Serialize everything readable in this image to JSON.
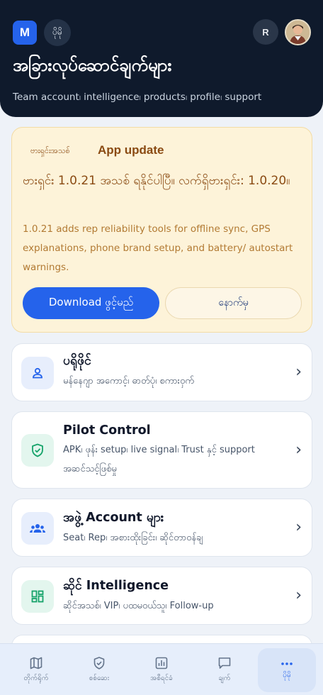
{
  "header": {
    "logo_letter": "M",
    "more_label": "ပိုမို",
    "user_initial": "R",
    "title": "အခြားလုပ်ဆောင်ချက်များ",
    "subtitle": "Team account၊ intelligence၊ products၊ profile၊ support"
  },
  "update": {
    "badge": "ဗားရှင်းအသစ်",
    "title": "App update",
    "headline": "ဗားရှင်း 1.0.21 အသစ် ရနိုင်ပါပြီ။ လက်ရှိဗားရှင်း: 1.0.20။",
    "description": "1.0.21 adds rep reliability tools for offline sync, GPS explanations, phone brand setup, and battery/ autostart warnings.",
    "download_label": "Download ဖွင့်မည်",
    "later_label": "နောက်မှ"
  },
  "menu": [
    {
      "title": "ပရိုဖိုင်",
      "desc": "မန်နေဂျာ အကောင့်၊ ဓာတ်ပုံ၊ စကားဝှက်",
      "icon": "user-icon"
    },
    {
      "title": "Pilot Control",
      "desc": "APK၊ ဖုန်း setup၊ live signal၊ Trust နှင့် support အဆင်သင့်ဖြစ်မှု",
      "icon": "shield-check-icon"
    },
    {
      "title": "အဖွဲ့ Account များ",
      "desc": "Seat၊ Rep၊ အစားထိုးခြင်း၊ ဆိုင်တာဝန်ချ",
      "icon": "group-icon"
    },
    {
      "title": "ဆိုင် Intelligence",
      "desc": "ဆိုင်အသစ်၊ VIP၊ ပထမဝယ်သူ၊ Follow-up",
      "icon": "dashboard-icon"
    }
  ],
  "nav": [
    {
      "label": "တိုက်ရိုက်",
      "icon": "map-icon"
    },
    {
      "label": "စစ်ဆေး",
      "icon": "shield-icon"
    },
    {
      "label": "အစီရင်ခံ",
      "icon": "report-icon"
    },
    {
      "label": "ချက်",
      "icon": "chat-icon"
    },
    {
      "label": "ပိုမို",
      "icon": "more-icon"
    }
  ],
  "colors": {
    "header_bg": "#0f1a2c",
    "accent": "#2563eb",
    "update_bg": "#fdf3d9",
    "update_text": "#8a4a12"
  }
}
